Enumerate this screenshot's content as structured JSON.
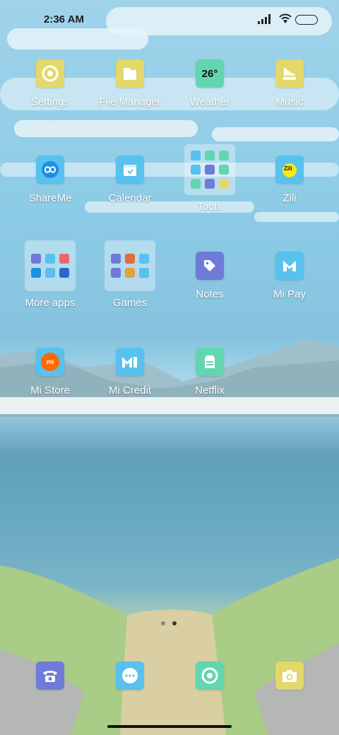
{
  "status_bar": {
    "time": "2:36 AM"
  },
  "apps": {
    "settings": "Settings",
    "file_manager": "File Manager",
    "weather": "Weather",
    "weather_temp": "26°",
    "music": "Music",
    "shareme": "ShareMe",
    "calendar": "Calendar",
    "tools": "Tools",
    "zili": "Zili",
    "more_apps": "More apps",
    "games": "Games",
    "notes": "Notes",
    "mi_pay": "Mi Pay",
    "mi_store": "Mi Store",
    "mi_credit": "Mi Credit",
    "netflix": "Netflix"
  },
  "colors": {
    "yellow_icon": "#e3d86a",
    "green_icon": "#62d6b0",
    "blue_icon": "#58c1ee",
    "indigo_icon": "#6f7bd8",
    "mi_orange": "#ff6900"
  },
  "page_indicator": {
    "pages": 2,
    "current": 2
  }
}
